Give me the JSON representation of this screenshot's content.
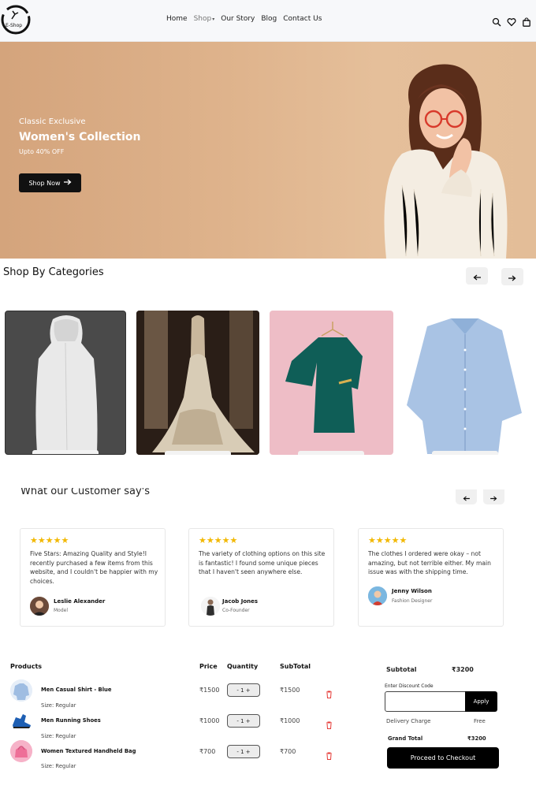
{
  "nav": {
    "logo_text": "E-Shop",
    "links": [
      "Home",
      "Shop",
      "Our Story",
      "Blog",
      "Contact Us"
    ],
    "icons": [
      "search-icon",
      "heart-icon",
      "bag-icon"
    ]
  },
  "hero": {
    "kicker": "Classic Exclusive",
    "title": "Women's Collection",
    "subtitle": "Upto 40% OFF",
    "button": "Shop Now"
  },
  "categories": {
    "title": "Shop By Categories",
    "items": [
      "hoodie",
      "wedding-gown",
      "teal-dress",
      "blue-shirt"
    ]
  },
  "testimonials": {
    "title": "What our Customer say's",
    "cards": [
      {
        "stars": "★★★★★",
        "quote": "Five Stars: Amazing Quality and Style!I recently purchased a few items from this website, and I couldn't be happier with my choices.",
        "name": "Leslie Alexander",
        "role": "Model"
      },
      {
        "stars": "★★★★★",
        "quote": "The variety of clothing options on this site is fantastic! I found some unique pieces that I haven't seen anywhere else.",
        "name": "Jacob Jones",
        "role": "Co-Founder"
      },
      {
        "stars": "★★★★★",
        "quote": "The clothes I ordered were okay – not amazing, but not terrible either. My main issue was with the shipping time.",
        "name": "Jenny Wilson",
        "role": "Fashion Designer"
      }
    ]
  },
  "cart": {
    "headers": {
      "products": "Products",
      "price": "Price",
      "quantity": "Quantity",
      "subtotal": "SubTotal"
    },
    "items": [
      {
        "name": "Men Casual Shirt - Blue",
        "size": "Size: Regular",
        "price": "₹1500",
        "qty": "- 1 +",
        "subtotal": "₹1500"
      },
      {
        "name": "Men Running Shoes",
        "size": "Size: Regular",
        "price": "₹1000",
        "qty": "- 1 +",
        "subtotal": "₹1000"
      },
      {
        "name": "Women Textured Handheld Bag",
        "size": "Size: Regular",
        "price": "₹700",
        "qty": "- 1 +",
        "subtotal": "₹700"
      }
    ]
  },
  "summary": {
    "subtotal_label": "Subtotal",
    "subtotal_value": "₹3200",
    "discount_label": "Enter Discount Code",
    "discount_value": "",
    "apply": "Apply",
    "delivery_label": "Delivery Charge",
    "delivery_value": "Free",
    "grand_label": "Grand Total",
    "grand_value": "₹3200",
    "checkout": "Proceed to Checkout"
  },
  "colors": {
    "star": "#f2b800",
    "accent": "#000000",
    "hero_bg": "#dfb48d",
    "trash": "#e53935"
  }
}
